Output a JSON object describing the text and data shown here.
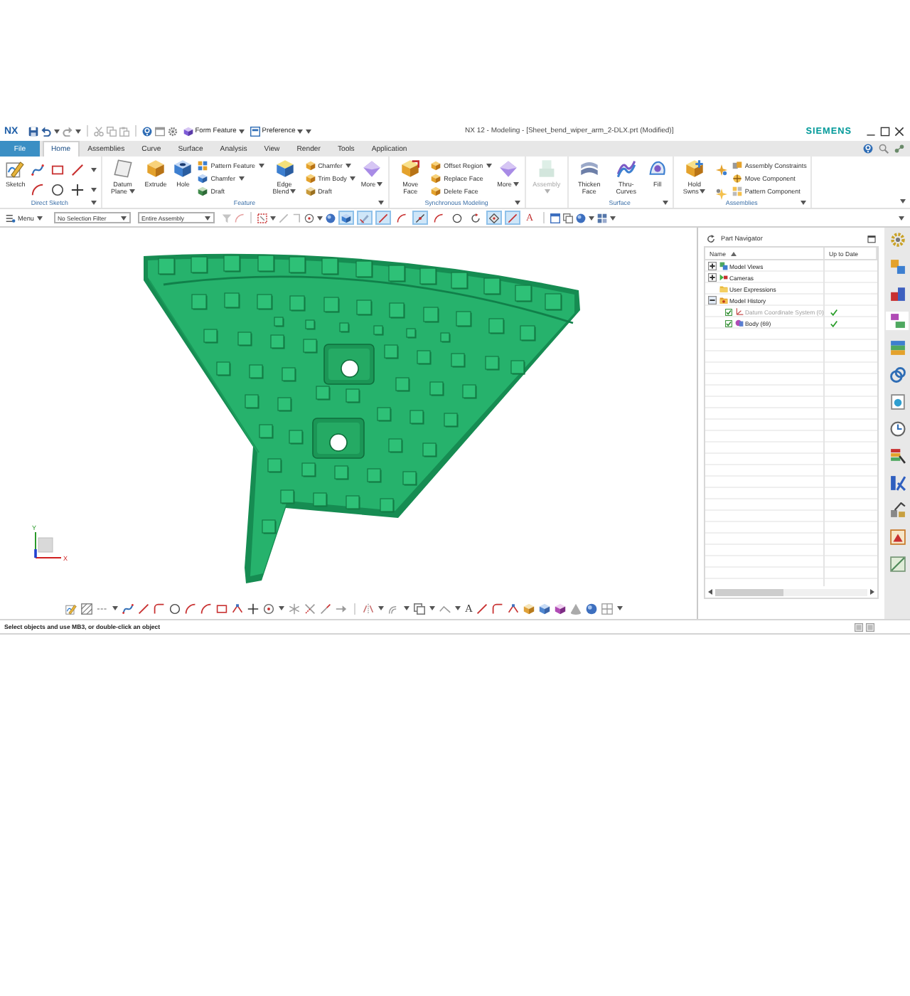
{
  "title_bar": {
    "logo": "NX",
    "quick_access": [
      {
        "label": "Form Feature",
        "dropdown": true
      },
      {
        "label": "Preference",
        "dropdown": true
      }
    ],
    "title": "NX 12 - Modeling - [Sheet_bend_wiper_arm_2-DLX.prt (Modified)]",
    "brand": "SIEMENS"
  },
  "tabs": [
    {
      "label": "File",
      "kind": "file",
      "selected": false
    },
    {
      "label": "Home",
      "kind": "tab",
      "selected": true
    },
    {
      "label": "Assemblies",
      "kind": "tab",
      "selected": false
    },
    {
      "label": "Curve",
      "kind": "tab",
      "selected": false
    },
    {
      "label": "Surface",
      "kind": "tab",
      "selected": false
    },
    {
      "label": "Analysis",
      "kind": "tab",
      "selected": false
    },
    {
      "label": "View",
      "kind": "tab",
      "selected": false
    },
    {
      "label": "Render",
      "kind": "tab",
      "selected": false
    },
    {
      "label": "Tools",
      "kind": "tab",
      "selected": false
    },
    {
      "label": "Application",
      "kind": "tab",
      "selected": false
    }
  ],
  "ribbon": [
    {
      "label": "Direct Sketch",
      "buttons": [
        {
          "kind": "large",
          "label": "Sketch",
          "dropdown": false,
          "disabled": false
        },
        {
          "kind": "tool_grid"
        }
      ]
    },
    {
      "label": "Feature",
      "buttons": [
        {
          "kind": "large",
          "label": "Datum Plane",
          "dropdown": true,
          "disabled": false
        },
        {
          "kind": "large",
          "label": "Extrude",
          "dropdown": false,
          "disabled": false
        },
        {
          "kind": "large",
          "label": "Hole",
          "dropdown": false,
          "disabled": false
        },
        {
          "kind": "stack",
          "items": [
            {
              "label": "Pattern Feature",
              "dropdown": true
            },
            {
              "label": "Chamfer",
              "dropdown": true
            },
            {
              "label": "Draft",
              "dropdown": false
            }
          ]
        },
        {
          "kind": "large",
          "label": "Edge Blend",
          "dropdown": true,
          "disabled": false
        },
        {
          "kind": "stack",
          "items": [
            {
              "label": "Chamfer",
              "dropdown": true
            },
            {
              "label": "Trim Body",
              "dropdown": true
            },
            {
              "label": "Draft",
              "dropdown": false
            }
          ]
        },
        {
          "kind": "large",
          "label": "More",
          "dropdown": true,
          "disabled": false
        }
      ]
    },
    {
      "label": "Synchronous Modeling",
      "buttons": [
        {
          "kind": "large",
          "label": "Move Face",
          "dropdown": false,
          "disabled": false
        },
        {
          "kind": "stack",
          "items": [
            {
              "label": "Offset Region",
              "dropdown": true
            },
            {
              "label": "Replace Face",
              "dropdown": false
            },
            {
              "label": "Delete Face",
              "dropdown": false
            }
          ]
        },
        {
          "kind": "large",
          "label": "More",
          "dropdown": true,
          "disabled": false
        }
      ]
    },
    {
      "buttons": [
        {
          "kind": "large",
          "label": "Assembly",
          "dropdown": true,
          "disabled": true
        }
      ]
    },
    {
      "label": "Surface",
      "buttons": [
        {
          "kind": "large",
          "label": "Thicken Face",
          "dropdown": false,
          "disabled": false
        },
        {
          "kind": "large",
          "label": "Thru-Curves",
          "dropdown": false,
          "disabled": false
        },
        {
          "kind": "large",
          "label": "Fill",
          "dropdown": false,
          "disabled": false
        }
      ]
    },
    {
      "label": "Assemblies",
      "buttons": [
        {
          "kind": "large",
          "label": "Hold Swns",
          "dropdown": true,
          "disabled": false
        },
        {
          "kind": "tool_column"
        },
        {
          "kind": "stack",
          "items": [
            {
              "label": "Assembly Constraints",
              "dropdown": false
            },
            {
              "label": "Move Component",
              "dropdown": false
            },
            {
              "label": "Pattern Component",
              "dropdown": false
            }
          ]
        }
      ]
    }
  ],
  "selection_bar": {
    "menu": "Menu",
    "filter": "No Selection Filter",
    "scope": "Entire Assembly",
    "snap_points": [
      {
        "on": true
      },
      {
        "on": true
      },
      {
        "on": true
      },
      {
        "on": false
      },
      {
        "on": true
      },
      {
        "on": false
      },
      {
        "on": false
      },
      {
        "on": false
      },
      {
        "on": true
      },
      {
        "on": true
      },
      {
        "on": false,
        "glyph": "A"
      }
    ]
  },
  "view_triad": {
    "x_label": "X",
    "y_label": "Y"
  },
  "sketch_toolbar": {
    "text_glyph": "A"
  },
  "part_navigator": {
    "title": "Part Navigator",
    "columns": [
      {
        "label": "Name",
        "sorted": true
      },
      {
        "label": "Up to Date",
        "sorted": false
      }
    ],
    "tree": [
      {
        "label": "Model Views",
        "kind": "branch",
        "expanded": false
      },
      {
        "label": "Cameras",
        "kind": "branch",
        "expanded": false
      },
      {
        "label": "User Expressions",
        "kind": "leaf",
        "expanded": false
      },
      {
        "label": "Model History",
        "kind": "branch",
        "expanded": true,
        "children": [
          {
            "label": "Datum Coordinate System (0)",
            "checked": true,
            "dimmed": true,
            "up_to_date": true
          },
          {
            "label": "Body (69)",
            "checked": true,
            "dimmed": false,
            "up_to_date": true
          }
        ]
      }
    ]
  },
  "resource_bar": [
    {
      "selected": false
    },
    {
      "selected": false
    },
    {
      "selected": false
    },
    {
      "selected": true
    },
    {
      "selected": false
    },
    {
      "selected": false
    },
    {
      "selected": false
    },
    {
      "selected": false
    },
    {
      "selected": false
    },
    {
      "selected": false
    },
    {
      "selected": false
    },
    {
      "selected": false
    },
    {
      "selected": false
    }
  ],
  "status_bar": {
    "message": "Select objects and use MB3, or double-click an object"
  }
}
